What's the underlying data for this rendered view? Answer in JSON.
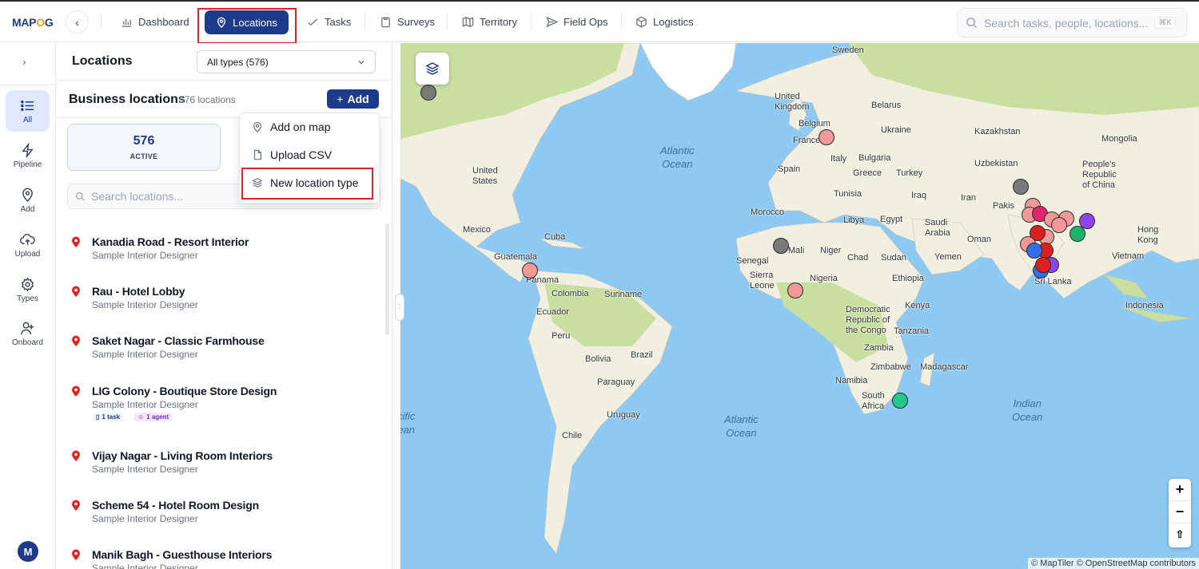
{
  "app": {
    "logo_text": "MAPOG"
  },
  "nav": {
    "items": [
      {
        "label": "Dashboard",
        "icon": "bar-chart-icon"
      },
      {
        "label": "Locations",
        "icon": "map-pin-icon",
        "active": true
      },
      {
        "label": "Tasks",
        "icon": "check-icon"
      },
      {
        "label": "Surveys",
        "icon": "clipboard-icon"
      },
      {
        "label": "Territory",
        "icon": "map-icon"
      },
      {
        "label": "Field Ops",
        "icon": "send-icon"
      },
      {
        "label": "Logistics",
        "icon": "package-icon"
      }
    ],
    "search_placeholder": "Search tasks, people, locations...",
    "search_shortcut": "⌘K"
  },
  "rail": {
    "items": [
      {
        "label": "All",
        "icon": "list-icon",
        "active": true
      },
      {
        "label": "Pipeline",
        "icon": "lightning-icon"
      },
      {
        "label": "Add",
        "icon": "map-pin-icon"
      },
      {
        "label": "Upload",
        "icon": "cloud-upload-icon"
      },
      {
        "label": "Types",
        "icon": "gear-icon"
      },
      {
        "label": "Onboard",
        "icon": "user-plus-icon"
      }
    ],
    "avatar_initial": "M"
  },
  "panel": {
    "title": "Locations",
    "type_filter": "All types (576)",
    "section_title": "Business locations",
    "section_count": "576 locations",
    "add_label": "Add",
    "stat": {
      "value": "576",
      "label": "ACTIVE"
    },
    "search_placeholder": "Search locations...",
    "locations": [
      {
        "name": "Kanadia Road - Resort Interior",
        "type": "Sample Interior Designer"
      },
      {
        "name": "Rau - Hotel Lobby",
        "type": "Sample Interior Designer"
      },
      {
        "name": "Saket Nagar - Classic Farmhouse",
        "type": "Sample Interior Designer"
      },
      {
        "name": "LIG Colony - Boutique Store Design",
        "type": "Sample Interior Designer",
        "tasks": "1 task",
        "agents": "1 agent"
      },
      {
        "name": "Vijay Nagar - Living Room Interiors",
        "type": "Sample Interior Designer"
      },
      {
        "name": "Scheme 54 - Hotel Room Design",
        "type": "Sample Interior Designer"
      },
      {
        "name": "Manik Bagh - Guesthouse Interiors",
        "type": "Sample Interior Designer"
      }
    ]
  },
  "add_menu": {
    "items": [
      {
        "label": "Add on map",
        "icon": "map-pin-icon"
      },
      {
        "label": "Upload CSV",
        "icon": "file-icon"
      },
      {
        "label": "New location type",
        "icon": "layers-icon"
      }
    ]
  },
  "map": {
    "attribution": "© MapTiler © OpenStreetMap contributors",
    "zoom_in": "+",
    "zoom_out": "−",
    "compass": "⇧",
    "colors": {
      "water": "#8dc9f3",
      "land": "#f1efe0",
      "green": "#c9dfa0"
    },
    "countries": [
      "Sweden",
      "United Kingdom",
      "Belarus",
      "Belgium",
      "Ukraine",
      "France",
      "Kazakhstan",
      "Mongolia",
      "Italy",
      "Bulgaria",
      "Uzbekistan",
      "Spain",
      "Greece",
      "Turkey",
      "People's Republic of China",
      "Tunisia",
      "Iraq",
      "Iran",
      "Morocco",
      "Libya",
      "Egypt",
      "Saudi Arabia",
      "Pakis",
      "Oman",
      "Hong Kong",
      "Mali",
      "Niger",
      "Chad",
      "Sudan",
      "Yemen",
      "Senegal",
      "Vietnam",
      "Sierra Leone",
      "Nigeria",
      "Ethiopia",
      "Sri Lanka",
      "Kenya",
      "Democratic Republic of the Congo",
      "Indonesia",
      "Tanzania",
      "Zambia",
      "Zimbabwe",
      "Madagascar",
      "Namibia",
      "South Africa",
      "United States",
      "Mexico",
      "Cuba",
      "Guatemala",
      "Panama",
      "Colombia",
      "Suriname",
      "Ecuador",
      "Peru",
      "Brazil",
      "Bolivia",
      "Paraguay",
      "Uruguay",
      "Chile"
    ],
    "oceans": [
      "Atlantic Ocean",
      "Atlantic Ocean",
      "Indian Ocean",
      "Pacific Ocean"
    ]
  }
}
